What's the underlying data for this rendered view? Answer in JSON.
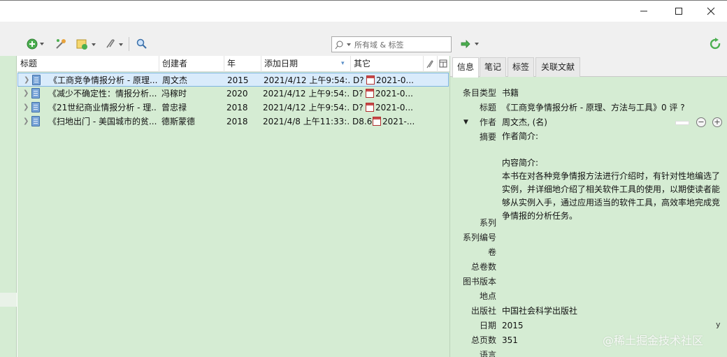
{
  "window": {
    "controls": [
      "minimize-icon",
      "maximize-icon",
      "close-icon"
    ]
  },
  "toolbar": {
    "buttons": [
      "new-item-icon",
      "add-by-identifier-icon",
      "new-note-icon",
      "attachment-icon",
      "advanced-search-icon"
    ],
    "search_placeholder": "所有域 & 标签",
    "locate_icon": "arrow-right-icon",
    "sync_icon": "sync-icon"
  },
  "itemlist": {
    "columns": [
      "标题",
      "创建者",
      "年",
      "添加日期",
      "其它"
    ],
    "rows": [
      {
        "title": "《工商竞争情报分析 - 原理...",
        "creator": "周文杰",
        "year": "2015",
        "added": "2021/4/12 上午9:54:...",
        "extra_prefix": "D?",
        "extra_date": "2021-0..."
      },
      {
        "title": "《减少不确定性：情报分析...",
        "creator": "冯稼时",
        "year": "2020",
        "added": "2021/4/12 上午9:54:...",
        "extra_prefix": "D?",
        "extra_date": "2021-0..."
      },
      {
        "title": "《21世纪商业情报分析 - 理...",
        "creator": "曾忠禄",
        "year": "2018",
        "added": "2021/4/12 上午9:54:...",
        "extra_prefix": "D?",
        "extra_date": "2021-0..."
      },
      {
        "title": "《扫地出门 - 美国城市的贫...",
        "creator": "德斯蒙德",
        "year": "2018",
        "added": "2021/4/8 上午11:33:...",
        "extra_prefix": "D8.6",
        "extra_date": "2021-..."
      }
    ]
  },
  "detail": {
    "tabs": [
      "信息",
      "笔记",
      "标签",
      "关联文献"
    ],
    "fields": {
      "item_type_label": "条目类型",
      "item_type": "书籍",
      "title_label": "标题",
      "title": "《工商竞争情报分析 - 原理、方法与工具》0 评 ?",
      "author_label": "作者",
      "author": "周文杰, (名)",
      "abstract_label": "摘要",
      "abstract_lines": [
        "作者简介:",
        "",
        "内容简介:",
        "本书在对各种竞争情报方法进行介绍时，有针对性地编选了实例，并详细地介绍了相关软件工具的使用，以期使读者能够从实例入手，通过应用适当的软件工具，高效率地完成竞争情报的分析任务。"
      ],
      "series_label": "系列",
      "series_number_label": "系列编号",
      "volume_label": "卷",
      "num_volumes_label": "总卷数",
      "edition_label": "图书版本",
      "place_label": "地点",
      "publisher_label": "出版社",
      "publisher": "中国社会科学出版社",
      "date_label": "日期",
      "date": "2015",
      "date_suffix": "y",
      "pages_label": "总页数",
      "pages": "351",
      "language_label": "语言"
    }
  },
  "watermark": "@稀土掘金技术社区"
}
